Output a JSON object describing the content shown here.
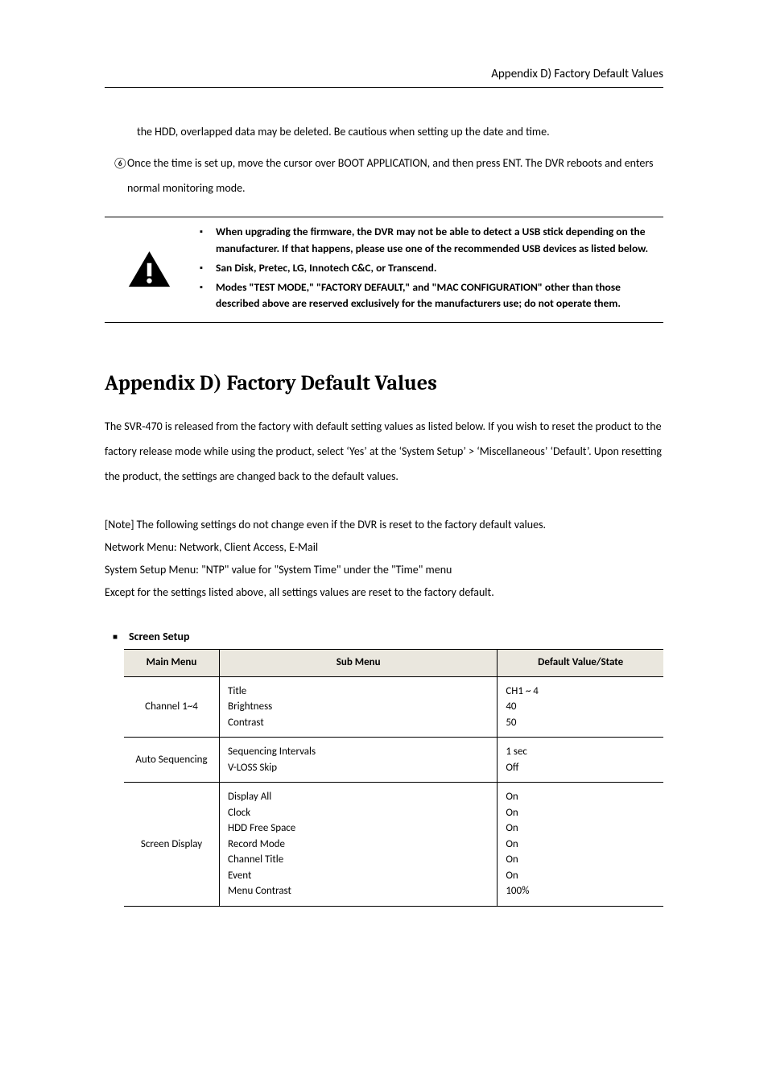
{
  "header": {
    "title": "Appendix D) Factory Default Values"
  },
  "intro": {
    "hdd_note": "the HDD, overlapped data may be deleted. Be cautious when setting up the date and time.",
    "step6_num": "⑥",
    "step6_text": "Once the time is set up, move the cursor over BOOT APPLICATION, and then press ENT. The DVR reboots and enters normal monitoring mode."
  },
  "caution": {
    "items": [
      "When upgrading the firmware, the DVR may not be able to detect a USB stick depending on the manufacturer. If that happens, please use one of the recommended USB devices as listed below.",
      "San Disk, Pretec, LG, Innotech C&C, or Transcend.",
      "Modes \"TEST MODE,\" \"FACTORY DEFAULT,\" and \"MAC CONFIGURATION\" other than those described above are reserved exclusively for the manufacturers use; do not operate them."
    ]
  },
  "appendix": {
    "title": "Appendix D) Factory Default Values",
    "intro_text": "The SVR-470 is released from the factory with default setting values as listed below. If you wish to reset the product to the factory release mode while using the product, select ‘Yes’ at the ‘System Setup’ > ‘Miscellaneous’ ‘Default’. Upon resetting the product, the settings are changed back to the default values.",
    "note_lines": [
      "[Note] The following settings do not change even if the DVR is reset to the factory default values.",
      "Network Menu: Network, Client Access, E-Mail",
      "System Setup Menu: \"NTP\" value for \"System Time\" under the \"Time\" menu",
      "Except for the settings listed above, all settings values are reset to the factory default."
    ]
  },
  "screen_setup": {
    "label": "Screen Setup",
    "headers": {
      "main": "Main Menu",
      "sub": "Sub Menu",
      "default": "Default Value/State"
    },
    "rows": [
      {
        "main": "Channel 1~4",
        "sub": "Title\nBrightness\nContrast",
        "default": "CH1 ~ 4\n40\n50"
      },
      {
        "main": "Auto Sequencing",
        "sub": "Sequencing Intervals\nV-LOSS Skip",
        "default": "1 sec\nOff"
      },
      {
        "main": "Screen Display",
        "sub": "Display All\nClock\nHDD Free Space\nRecord Mode\nChannel Title\nEvent\nMenu Contrast",
        "default": "On\nOn\nOn\nOn\nOn\nOn\n100%"
      }
    ]
  }
}
